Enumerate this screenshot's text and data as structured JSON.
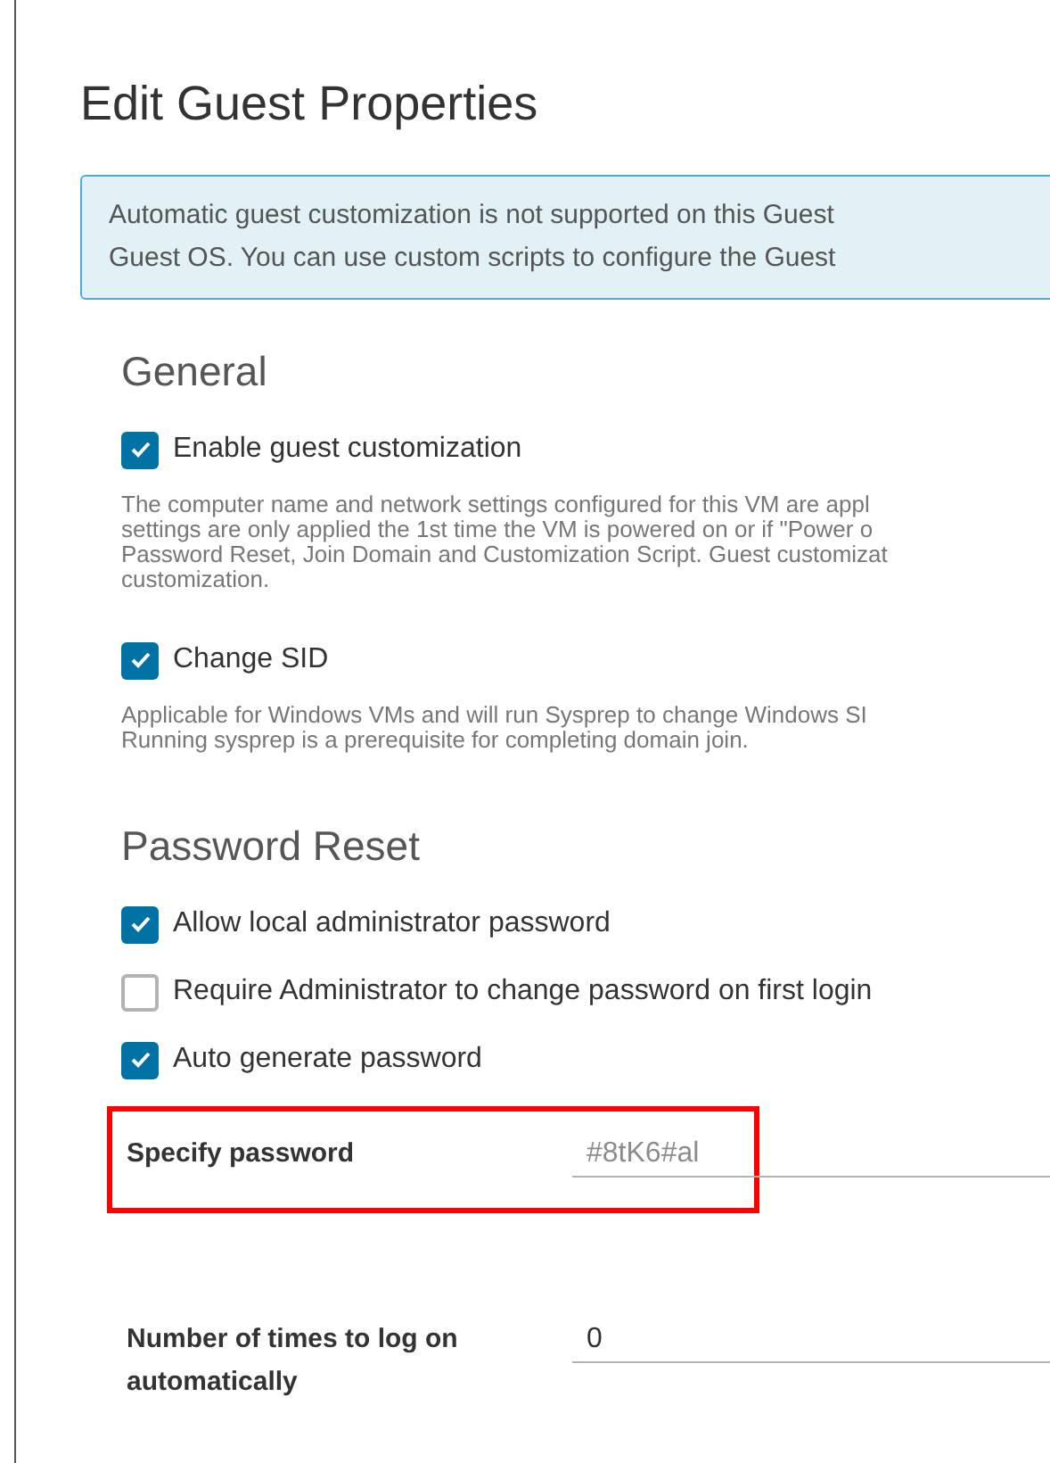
{
  "title": "Edit Guest Properties",
  "info": {
    "lines": [
      "Automatic guest customization is not supported on this Guest",
      "Guest OS. You can use custom scripts to configure the Guest"
    ]
  },
  "sections": [
    {
      "heading": "General",
      "options": [
        {
          "kind": "checkbox",
          "label": "Enable guest customization",
          "checked": true,
          "description": [
            "The computer name and network settings configured for this VM are appl",
            "settings are only applied the 1st time the VM is powered on or if \"Power o",
            "Password Reset, Join Domain and Customization Script. Guest customizat",
            "customization."
          ]
        },
        {
          "kind": "checkbox",
          "label": "Change SID",
          "checked": true,
          "description": [
            "Applicable for Windows VMs and will run Sysprep to change Windows SI",
            "Running sysprep is a prerequisite for completing domain join."
          ]
        }
      ]
    },
    {
      "heading": "Password Reset",
      "options": [
        {
          "kind": "checkbox",
          "label": "Allow local administrator password",
          "checked": true
        },
        {
          "kind": "checkbox",
          "label": "Require Administrator to change password on first login",
          "checked": false
        },
        {
          "kind": "checkbox",
          "label": "Auto generate password",
          "checked": true
        },
        {
          "kind": "field",
          "label": "Specify password",
          "value": "#8tK6#al",
          "disabled": true,
          "highlighted": true
        },
        {
          "kind": "field",
          "label": "Number of times to log on automatically",
          "value": "0",
          "disabled": false,
          "highlighted": false
        }
      ]
    }
  ]
}
